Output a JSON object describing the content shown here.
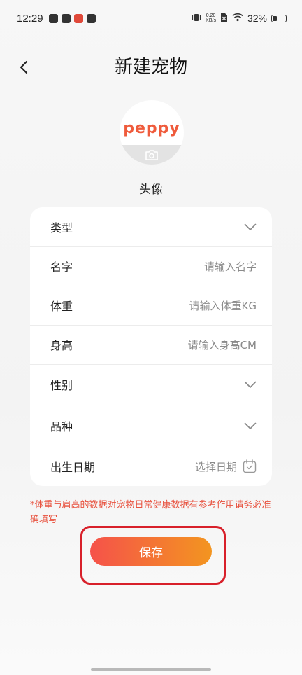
{
  "status_bar": {
    "time": "12:29",
    "net_speed_value": "0.20",
    "net_speed_unit": "KB/s",
    "battery": "32%"
  },
  "header": {
    "title": "新建宠物",
    "back_icon": "chevron-left-icon"
  },
  "avatar": {
    "logo_text": "peppy",
    "camera_icon": "camera-icon",
    "label": "头像"
  },
  "form": {
    "rows": [
      {
        "label": "类型",
        "placeholder": "",
        "icon": "chevron-down-icon"
      },
      {
        "label": "名字",
        "placeholder": "请输入名字",
        "icon": ""
      },
      {
        "label": "体重",
        "placeholder": "请输入体重KG",
        "icon": ""
      },
      {
        "label": "身高",
        "placeholder": "请输入身高CM",
        "icon": ""
      },
      {
        "label": "性别",
        "placeholder": "",
        "icon": "chevron-down-icon"
      },
      {
        "label": "品种",
        "placeholder": "",
        "icon": "chevron-down-icon"
      },
      {
        "label": "出生日期",
        "placeholder": "选择日期",
        "icon": "calendar-icon"
      }
    ]
  },
  "note": "*体重与肩高的数据对宠物日常健康数据有参考作用请务必准确填写",
  "save_button": {
    "label": "保存"
  },
  "colors": {
    "accent": "#ef5b3c",
    "button_gradient_start": "#f5524a",
    "button_gradient_end": "#f39520",
    "note_text": "#e8513e",
    "highlight_border": "#d8202a"
  }
}
